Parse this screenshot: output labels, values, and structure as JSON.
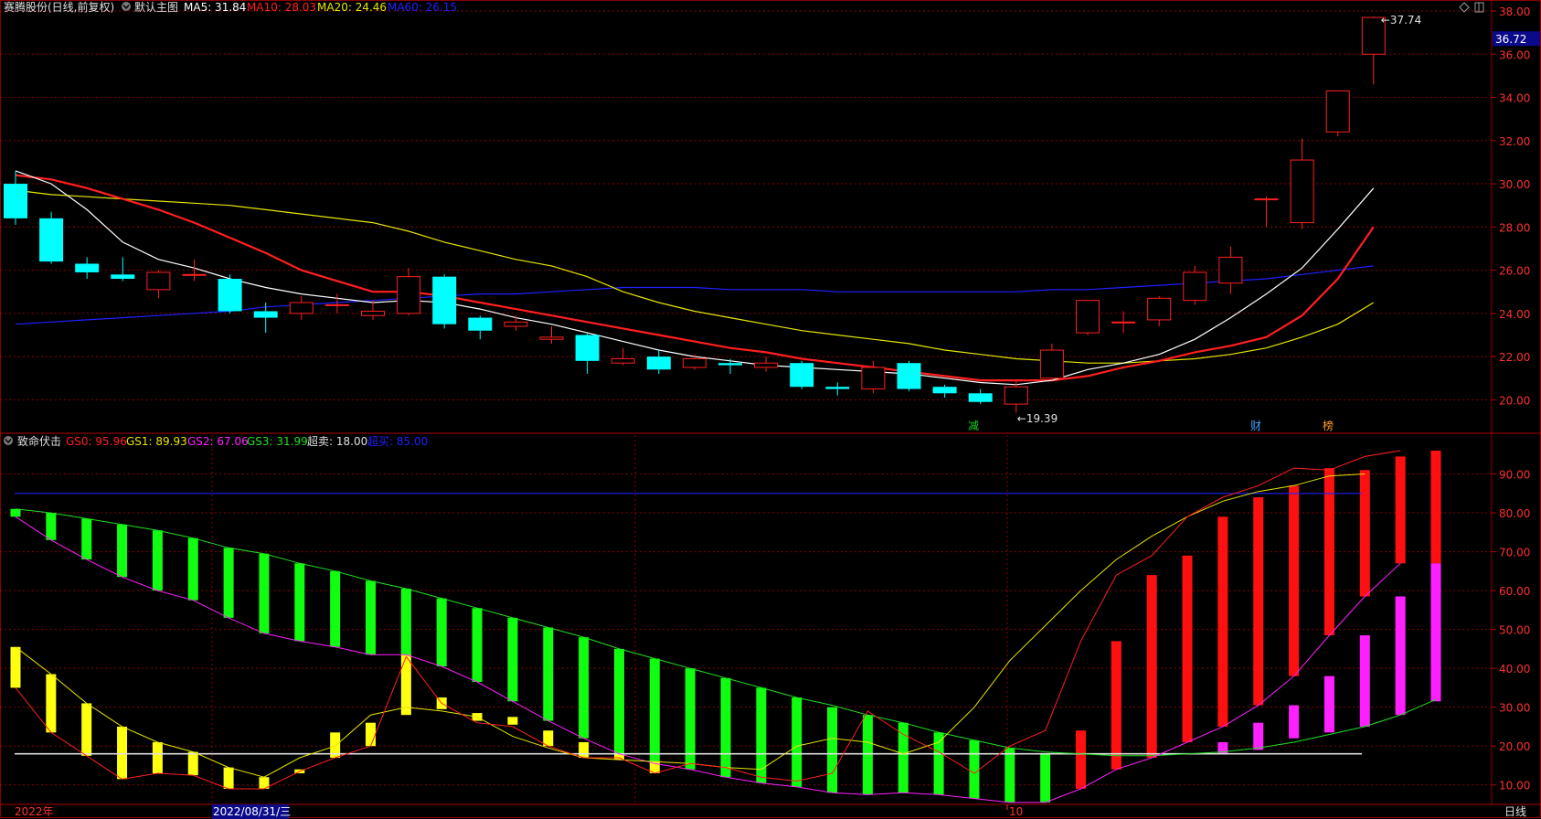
{
  "main_panel": {
    "title": "赛腾股份(日线,前复权)",
    "indicator_name": "默认主图",
    "ma5": {
      "label": "MA5: 31.84",
      "color": "#ffffff"
    },
    "ma10": {
      "label": "MA10: 28.03",
      "color": "#ff1f1f"
    },
    "ma20": {
      "label": "MA20: 24.46",
      "color": "#e6e600"
    },
    "ma60": {
      "label": "MA60: 26.15",
      "color": "#2020ff"
    },
    "high_marker": "37.74",
    "low_marker": "19.39",
    "last_price": "36.72",
    "event_marks": [
      {
        "text": "减",
        "color": "#19d219"
      },
      {
        "text": "财",
        "color": "#40a0ff"
      },
      {
        "text": "榜",
        "color": "#ff9a2a"
      }
    ]
  },
  "sub_panel": {
    "indicator_name": "致命伏击",
    "gs0": {
      "label": "GS0: 95.96",
      "color": "#ff2020"
    },
    "gs1": {
      "label": "GS1: 89.93",
      "color": "#e6e600"
    },
    "gs2": {
      "label": "GS2: 67.06",
      "color": "#ff20ff"
    },
    "gs3": {
      "label": "GS3: 31.99",
      "color": "#20e020"
    },
    "oversold": {
      "label": "超卖: 18.00",
      "color": "#e0e0e0"
    },
    "overbought": {
      "label": "超买: 85.00",
      "color": "#2020ff"
    }
  },
  "x_axis": {
    "start_label": "2022年",
    "cursor_date": "2022/08/31/三",
    "month_label": "10",
    "period_label": "日线"
  },
  "colors": {
    "up": "#ff2020",
    "down": "#00ffff",
    "grid": "#8b0000",
    "bg": "#000000"
  },
  "chart_data": [
    {
      "type": "candlestick",
      "title": "赛腾股份(日线,前复权)",
      "ylim": [
        19.0,
        38.0
      ],
      "y_ticks": [
        "20.00",
        "22.00",
        "24.00",
        "26.00",
        "28.00",
        "30.00",
        "32.00",
        "34.00",
        "36.00",
        "38.00"
      ],
      "candles": [
        {
          "o": 30.0,
          "h": 30.6,
          "l": 28.1,
          "c": 28.4
        },
        {
          "o": 28.4,
          "h": 28.7,
          "l": 26.3,
          "c": 26.4
        },
        {
          "o": 26.3,
          "h": 26.6,
          "l": 25.6,
          "c": 25.9
        },
        {
          "o": 25.8,
          "h": 26.6,
          "l": 25.5,
          "c": 25.6
        },
        {
          "o": 25.1,
          "h": 26.0,
          "l": 24.7,
          "c": 25.9
        },
        {
          "o": 25.8,
          "h": 26.5,
          "l": 25.5,
          "c": 25.8
        },
        {
          "o": 25.6,
          "h": 25.8,
          "l": 24.0,
          "c": 24.1
        },
        {
          "o": 24.1,
          "h": 24.5,
          "l": 23.1,
          "c": 23.8
        },
        {
          "o": 24.0,
          "h": 24.8,
          "l": 23.7,
          "c": 24.5
        },
        {
          "o": 24.4,
          "h": 24.9,
          "l": 24.0,
          "c": 24.4
        },
        {
          "o": 23.9,
          "h": 24.6,
          "l": 23.7,
          "c": 24.1
        },
        {
          "o": 24.0,
          "h": 26.1,
          "l": 23.9,
          "c": 25.7
        },
        {
          "o": 25.7,
          "h": 25.8,
          "l": 23.3,
          "c": 23.5
        },
        {
          "o": 23.8,
          "h": 23.9,
          "l": 22.8,
          "c": 23.2
        },
        {
          "o": 23.4,
          "h": 23.9,
          "l": 23.2,
          "c": 23.6
        },
        {
          "o": 22.8,
          "h": 23.4,
          "l": 22.6,
          "c": 22.9
        },
        {
          "o": 23.0,
          "h": 23.1,
          "l": 21.2,
          "c": 21.8
        },
        {
          "o": 21.7,
          "h": 22.4,
          "l": 21.6,
          "c": 21.9
        },
        {
          "o": 22.0,
          "h": 22.3,
          "l": 21.2,
          "c": 21.4
        },
        {
          "o": 21.5,
          "h": 22.1,
          "l": 21.4,
          "c": 21.9
        },
        {
          "o": 21.7,
          "h": 21.9,
          "l": 21.2,
          "c": 21.6
        },
        {
          "o": 21.5,
          "h": 22.0,
          "l": 21.3,
          "c": 21.7
        },
        {
          "o": 21.7,
          "h": 21.8,
          "l": 20.5,
          "c": 20.6
        },
        {
          "o": 20.6,
          "h": 20.8,
          "l": 20.2,
          "c": 20.5
        },
        {
          "o": 20.5,
          "h": 21.8,
          "l": 20.3,
          "c": 21.5
        },
        {
          "o": 21.7,
          "h": 21.8,
          "l": 20.4,
          "c": 20.5
        },
        {
          "o": 20.6,
          "h": 20.7,
          "l": 20.1,
          "c": 20.3
        },
        {
          "o": 20.3,
          "h": 20.5,
          "l": 19.8,
          "c": 19.9
        },
        {
          "o": 19.8,
          "h": 20.9,
          "l": 19.4,
          "c": 20.6
        },
        {
          "o": 21.0,
          "h": 22.6,
          "l": 20.9,
          "c": 22.3
        },
        {
          "o": 23.1,
          "h": 24.6,
          "l": 23.0,
          "c": 24.6
        },
        {
          "o": 23.6,
          "h": 24.1,
          "l": 23.1,
          "c": 23.6
        },
        {
          "o": 23.7,
          "h": 24.8,
          "l": 23.4,
          "c": 24.7
        },
        {
          "o": 24.6,
          "h": 26.2,
          "l": 24.4,
          "c": 25.9
        },
        {
          "o": 25.4,
          "h": 27.1,
          "l": 24.9,
          "c": 26.6
        },
        {
          "o": 29.3,
          "h": 29.4,
          "l": 28.0,
          "c": 29.3
        },
        {
          "o": 28.2,
          "h": 32.1,
          "l": 27.9,
          "c": 31.1
        },
        {
          "o": 32.4,
          "h": 34.3,
          "l": 32.2,
          "c": 34.3
        },
        {
          "o": 36.0,
          "h": 37.74,
          "l": 34.6,
          "c": 37.7
        }
      ],
      "ma5": [
        30.6,
        30.0,
        28.8,
        27.3,
        26.5,
        26.1,
        25.6,
        25.2,
        24.9,
        24.7,
        24.5,
        24.6,
        24.5,
        24.2,
        23.8,
        23.5,
        23.1,
        22.7,
        22.3,
        22.0,
        21.8,
        21.6,
        21.5,
        21.4,
        21.3,
        21.2,
        21.0,
        20.8,
        20.7,
        20.9,
        21.4,
        21.7,
        22.1,
        22.8,
        23.8,
        24.9,
        26.1,
        27.9,
        29.8
      ],
      "ma10": [
        30.4,
        30.2,
        29.8,
        29.3,
        28.8,
        28.2,
        27.5,
        26.8,
        26.0,
        25.5,
        25.0,
        25.0,
        24.8,
        24.5,
        24.2,
        23.9,
        23.6,
        23.3,
        23.0,
        22.7,
        22.4,
        22.2,
        21.9,
        21.7,
        21.5,
        21.3,
        21.1,
        20.9,
        20.9,
        20.9,
        21.1,
        21.5,
        21.8,
        22.2,
        22.5,
        22.9,
        23.9,
        25.6,
        28.0
      ],
      "ma20": [
        29.7,
        29.5,
        29.4,
        29.3,
        29.2,
        29.1,
        29.0,
        28.8,
        28.6,
        28.4,
        28.2,
        27.8,
        27.3,
        26.9,
        26.5,
        26.2,
        25.7,
        25.0,
        24.5,
        24.1,
        23.8,
        23.5,
        23.2,
        23.0,
        22.8,
        22.6,
        22.3,
        22.1,
        21.9,
        21.8,
        21.7,
        21.7,
        21.8,
        21.9,
        22.1,
        22.4,
        22.9,
        23.5,
        24.5
      ],
      "ma60": [
        23.5,
        23.6,
        23.7,
        23.8,
        23.9,
        24.0,
        24.1,
        24.3,
        24.4,
        24.5,
        24.6,
        24.7,
        24.8,
        24.9,
        24.9,
        25.0,
        25.1,
        25.2,
        25.2,
        25.2,
        25.1,
        25.1,
        25.1,
        25.0,
        25.0,
        25.0,
        25.0,
        25.0,
        25.0,
        25.1,
        25.1,
        25.2,
        25.3,
        25.4,
        25.5,
        25.6,
        25.8,
        26.0,
        26.2
      ]
    },
    {
      "type": "bar",
      "title": "致命伏击",
      "ylim": [
        5,
        100
      ],
      "y_ticks": [
        "10.00",
        "20.00",
        "30.00",
        "40.00",
        "50.00",
        "60.00",
        "70.00",
        "80.00",
        "90.00"
      ],
      "oversold": 18,
      "overbought": 85,
      "series": [
        {
          "name": "GS0",
          "values": [
            81.5,
            80.5,
            79,
            77.5,
            76,
            74,
            71.5,
            69.5,
            67.5,
            65.5,
            63,
            61,
            59,
            56.5,
            54,
            51.5,
            48.5,
            45.5,
            42.5,
            39.5,
            36.5,
            34,
            31.5,
            29,
            26.5,
            24,
            21.5,
            19.5,
            17.5,
            16.5,
            17.5,
            18.5,
            20,
            22,
            25,
            28,
            32,
            35,
            38
          ]
        },
        {
          "name": "GS1",
          "values": [
            45.5,
            38.5,
            31,
            25,
            21,
            18.5,
            14.5,
            12,
            17,
            20,
            28,
            30,
            29,
            27.5,
            22.5,
            19.5,
            17,
            16.5,
            16,
            15.5,
            14.5,
            14,
            20,
            22,
            21,
            18,
            21,
            30,
            42,
            51,
            60,
            68,
            74,
            79,
            83,
            85.5,
            87,
            89.5,
            90
          ]
        },
        {
          "name": "GS2",
          "values": [
            79,
            73,
            68,
            63.5,
            60,
            57.5,
            53,
            49,
            47,
            45.5,
            43.5,
            43.5,
            40.5,
            36.5,
            31.5,
            26.5,
            22,
            18,
            15.5,
            14,
            12,
            10.5,
            9.5,
            8,
            7.5,
            8,
            7.5,
            6.5,
            5.5,
            5.5,
            9,
            14,
            17,
            21,
            25,
            30.5,
            38,
            48.5,
            58.5,
            67
          ]
        },
        {
          "name": "GS3",
          "values": [
            81,
            80,
            78.5,
            77,
            75.5,
            73.5,
            71,
            69.5,
            67,
            65,
            62.5,
            60.5,
            58,
            55.5,
            53,
            50.5,
            48,
            45,
            42.5,
            40,
            37.5,
            35,
            32.5,
            30.5,
            28,
            26,
            23.5,
            21.5,
            19.5,
            18.5,
            18,
            17.5,
            17.5,
            18,
            18.5,
            19.5,
            21,
            23,
            25,
            28,
            32
          ]
        },
        {
          "name": "GS0",
          "values": [
            35,
            23.5,
            17.5,
            11.5,
            13,
            12.5,
            9,
            9,
            13.5,
            17,
            20,
            43,
            31,
            26,
            25,
            20,
            17,
            17,
            13,
            15.5,
            14.5,
            12,
            11,
            13,
            29,
            23,
            18.5,
            13,
            20,
            24,
            47,
            64,
            69,
            79,
            84,
            87,
            91.5,
            91,
            94.5,
            96
          ]
        }
      ],
      "bar_top": [
        81,
        80,
        78.5,
        77,
        75.5,
        73.5,
        71,
        69.5,
        67,
        65,
        62.5,
        60.5,
        58,
        55.5,
        53,
        50.5,
        48,
        45,
        42.5,
        40,
        37.5,
        35,
        32.5,
        30,
        28,
        26,
        23.5,
        21.5,
        19.5,
        18,
        24,
        47,
        64,
        69,
        79,
        84,
        87,
        91.5,
        91,
        94.5,
        96
      ],
      "bar_bottom": [
        79,
        73,
        68,
        63.5,
        60,
        57.5,
        53,
        49,
        47,
        45.5,
        43.5,
        43.5,
        40.5,
        36.5,
        31.5,
        26.5,
        22,
        18,
        15.5,
        14,
        12,
        10.5,
        9.5,
        8,
        7.5,
        8,
        7.5,
        6.5,
        5.5,
        5.5,
        9,
        14,
        17,
        21,
        25,
        30.5,
        38,
        48.5,
        58.5,
        67
      ],
      "y_bars": [
        {
          "top": 45.5,
          "bottom": 35
        },
        {
          "top": 38.5,
          "bottom": 23.5
        },
        {
          "top": 31,
          "bottom": 17.5
        },
        {
          "top": 25,
          "bottom": 11.5
        },
        {
          "top": 21,
          "bottom": 13
        },
        {
          "top": 18.5,
          "bottom": 12.5
        },
        {
          "top": 14.5,
          "bottom": 9
        },
        {
          "top": 12,
          "bottom": 9
        },
        {
          "top": 14,
          "bottom": 13
        },
        {
          "top": 23.5,
          "bottom": 17
        },
        {
          "top": 26,
          "bottom": 20
        },
        {
          "top": 43.5,
          "bottom": 28
        },
        {
          "top": 32.5,
          "bottom": 29.5
        },
        {
          "top": 28.5,
          "bottom": 26.5
        },
        {
          "top": 27.5,
          "bottom": 25.5
        },
        {
          "top": 24,
          "bottom": 20
        },
        {
          "top": 21,
          "bottom": 17
        },
        {
          "top": 18,
          "bottom": 16.5
        },
        {
          "top": 16,
          "bottom": 13
        }
      ]
    }
  ]
}
